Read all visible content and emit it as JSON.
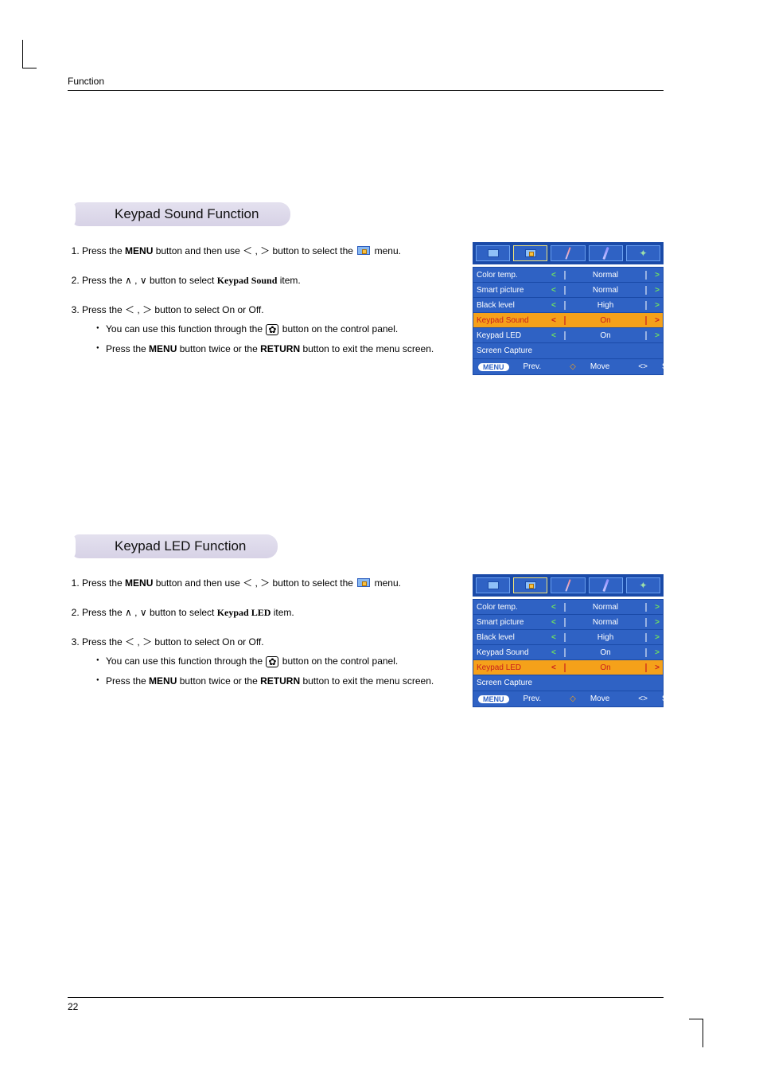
{
  "header": {
    "category": "Function"
  },
  "page_number": "22",
  "sections": [
    {
      "id": "sound",
      "heading": "Keypad Sound Function",
      "steps": {
        "s1_a": "Press the ",
        "s1_menu": "MENU",
        "s1_b": " button and then use ",
        "s1_c": " button to select the ",
        "s1_d": " menu.",
        "s2_a": "Press the ",
        "s2_b": " button to select ",
        "s2_item": "Keypad Sound",
        "s2_c": " item.",
        "s3_a": "Press the ",
        "s3_b": " button to select On or Off.",
        "sub1_a": "You can use this function through the ",
        "sub1_b": " button on the control panel.",
        "sub2_a": "Press the ",
        "sub2_menu": "MENU",
        "sub2_b": " button twice or the ",
        "sub2_return": "RETURN",
        "sub2_c": " button to exit the menu screen."
      },
      "osd": {
        "rows": [
          {
            "label": "Color temp.",
            "value": "Normal",
            "hl": false,
            "has_arrows": true
          },
          {
            "label": "Smart picture",
            "value": "Normal",
            "hl": false,
            "has_arrows": true
          },
          {
            "label": "Black level",
            "value": "High",
            "hl": false,
            "has_arrows": true
          },
          {
            "label": "Keypad Sound",
            "value": "On",
            "hl": true,
            "has_arrows": true
          },
          {
            "label": "Keypad LED",
            "value": "On",
            "hl": false,
            "has_arrows": true
          },
          {
            "label": "Screen Capture",
            "value": "",
            "hl": false,
            "has_arrows": false
          }
        ],
        "footer": {
          "menu": "MENU",
          "prev": "Prev.",
          "move": "Move",
          "select": "Select"
        }
      }
    },
    {
      "id": "led",
      "heading": "Keypad LED Function",
      "steps": {
        "s1_a": "Press the ",
        "s1_menu": "MENU",
        "s1_b": " button and then use ",
        "s1_c": " button to select the ",
        "s1_d": " menu.",
        "s2_a": "Press the ",
        "s2_b": " button to select ",
        "s2_item": "Keypad LED",
        "s2_c": " item.",
        "s3_a": "Press the ",
        "s3_b": " button to select On or Off.",
        "sub1_a": "You can use this function through the ",
        "sub1_b": " button on the control panel.",
        "sub2_a": "Press the ",
        "sub2_menu": "MENU",
        "sub2_b": " button twice or the ",
        "sub2_return": "RETURN",
        "sub2_c": " button to exit the menu screen."
      },
      "osd": {
        "rows": [
          {
            "label": "Color temp.",
            "value": "Normal",
            "hl": false,
            "has_arrows": true
          },
          {
            "label": "Smart picture",
            "value": "Normal",
            "hl": false,
            "has_arrows": true
          },
          {
            "label": "Black level",
            "value": "High",
            "hl": false,
            "has_arrows": true
          },
          {
            "label": "Keypad Sound",
            "value": "On",
            "hl": false,
            "has_arrows": true
          },
          {
            "label": "Keypad LED",
            "value": "On",
            "hl": true,
            "has_arrows": true
          },
          {
            "label": "Screen Capture",
            "value": "",
            "hl": false,
            "has_arrows": false
          }
        ],
        "footer": {
          "menu": "MENU",
          "prev": "Prev.",
          "move": "Move",
          "select": "Select"
        }
      }
    }
  ],
  "symbols": {
    "lt": "＜",
    "gt": "＞",
    "up": "∧",
    "down": "∨",
    "updown_glyph": "◇",
    "ltgt": "<>"
  }
}
